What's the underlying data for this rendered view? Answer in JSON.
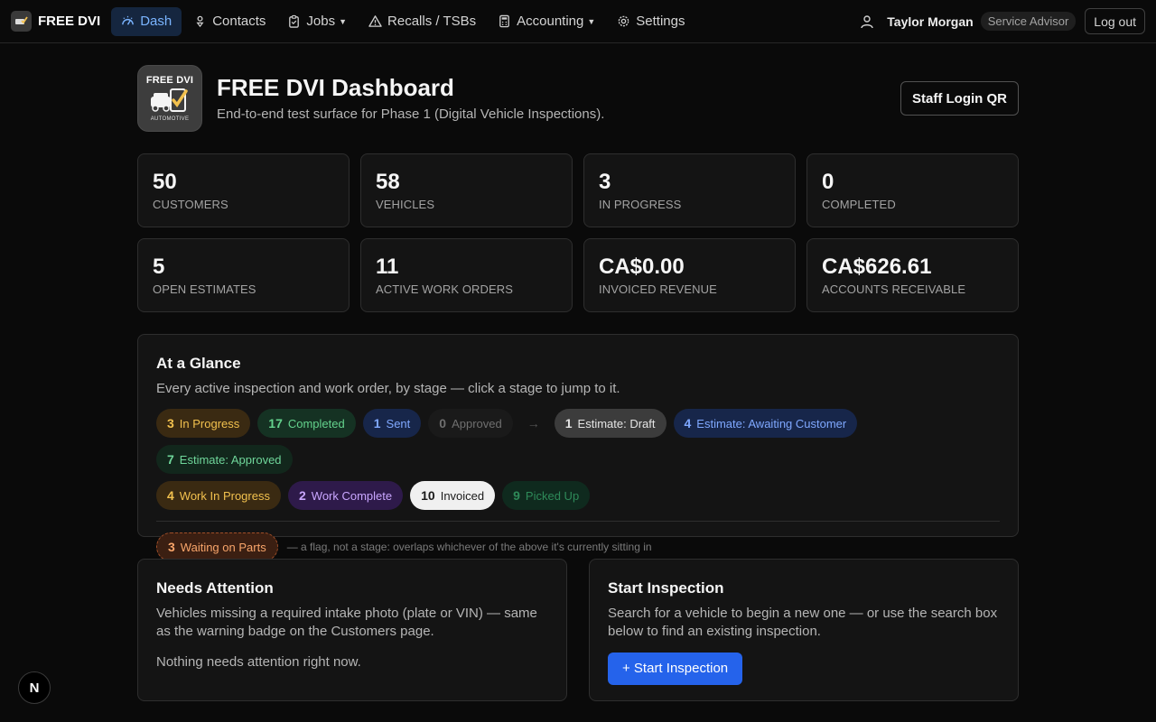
{
  "brand": {
    "name": "FREE DVI"
  },
  "nav": {
    "dash": "Dash",
    "contacts": "Contacts",
    "jobs": "Jobs",
    "recalls": "Recalls / TSBs",
    "accounting": "Accounting",
    "settings": "Settings"
  },
  "user": {
    "name": "Taylor Morgan",
    "role": "Service Advisor",
    "logout": "Log out"
  },
  "header": {
    "logo_top": "FREE DVI",
    "logo_bottom": "AUTOMOTIVE",
    "title": "FREE DVI Dashboard",
    "subtitle": "End-to-end test surface for Phase 1 (Digital Vehicle Inspections).",
    "qr_button": "Staff Login QR"
  },
  "stats": [
    {
      "value": "50",
      "label": "CUSTOMERS"
    },
    {
      "value": "58",
      "label": "VEHICLES"
    },
    {
      "value": "3",
      "label": "IN PROGRESS"
    },
    {
      "value": "0",
      "label": "COMPLETED"
    },
    {
      "value": "5",
      "label": "OPEN ESTIMATES"
    },
    {
      "value": "11",
      "label": "ACTIVE WORK ORDERS"
    },
    {
      "value": "CA$0.00",
      "label": "INVOICED REVENUE"
    },
    {
      "value": "CA$626.61",
      "label": "ACCOUNTS RECEIVABLE"
    }
  ],
  "glance": {
    "title": "At a Glance",
    "subtitle": "Every active inspection and work order, by stage — click a stage to jump to it.",
    "inspection_stages": [
      {
        "count": "3",
        "label": "In Progress"
      },
      {
        "count": "17",
        "label": "Completed"
      },
      {
        "count": "1",
        "label": "Sent"
      },
      {
        "count": "0",
        "label": "Approved"
      }
    ],
    "arrow": "→",
    "estimate_stages": [
      {
        "count": "1",
        "label": "Estimate: Draft"
      },
      {
        "count": "4",
        "label": "Estimate: Awaiting Customer"
      },
      {
        "count": "7",
        "label": "Estimate: Approved"
      }
    ],
    "work_stages": [
      {
        "count": "4",
        "label": "Work In Progress"
      },
      {
        "count": "2",
        "label": "Work Complete"
      },
      {
        "count": "10",
        "label": "Invoiced"
      },
      {
        "count": "9",
        "label": "Picked Up"
      }
    ],
    "flag": {
      "count": "3",
      "label": "Waiting on Parts"
    },
    "flag_note": "— a flag, not a stage: overlaps whichever of the above it's currently sitting in"
  },
  "attention": {
    "title": "Needs Attention",
    "subtitle": "Vehicles missing a required intake photo (plate or VIN) — same as the warning badge on the Customers page.",
    "empty": "Nothing needs attention right now."
  },
  "start": {
    "title": "Start Inspection",
    "subtitle": "Search for a vehicle to begin a new one — or use the search box below to find an existing inspection.",
    "button": "+ Start Inspection"
  },
  "badge": {
    "letter": "N"
  }
}
